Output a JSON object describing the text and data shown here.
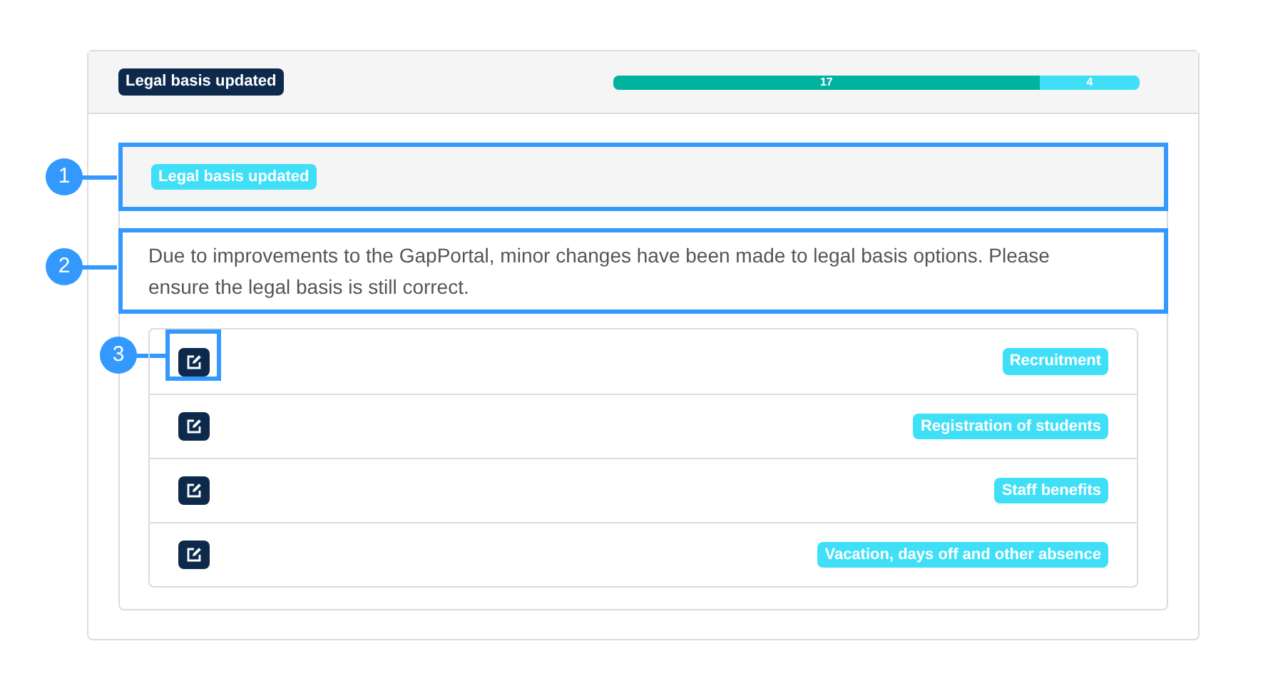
{
  "header": {
    "badge": "Legal basis updated",
    "progress": {
      "level": 0.81,
      "done_label": "17",
      "remaining_label": "4"
    }
  },
  "notice": {
    "badge": "Legal basis updated",
    "message": "Due to improvements to the GapPortal, minor changes have been made to legal basis options. Please ensure the legal basis is still correct."
  },
  "items": [
    {
      "label": "Recruitment"
    },
    {
      "label": "Registration of students"
    },
    {
      "label": "Staff benefits"
    },
    {
      "label": "Vacation, days off and other absence"
    }
  ],
  "callouts": [
    "1",
    "2",
    "3"
  ]
}
